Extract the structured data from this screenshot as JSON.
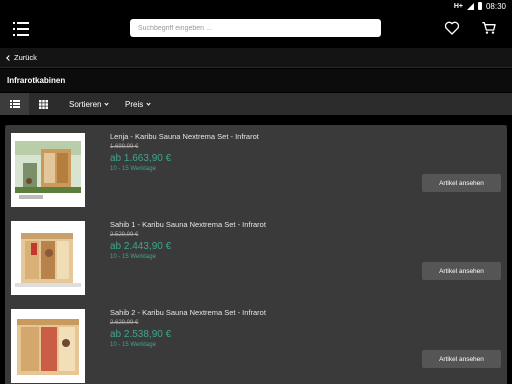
{
  "status_bar": {
    "network": "H+",
    "time": "08:30"
  },
  "header": {
    "menu_icon": "menu-icon",
    "search_placeholder": "Suchbegriff eingeben ...",
    "wishlist_icon": "heart-icon",
    "cart_icon": "cart-icon"
  },
  "nav": {
    "back_label": "Zurück"
  },
  "category": {
    "title": "Infrarotkabinen"
  },
  "toolbar": {
    "list_view_icon": "list-view-icon",
    "grid_view_icon": "grid-view-icon",
    "sort_label": "Sortieren",
    "price_label": "Preis"
  },
  "products": [
    {
      "name": "Lenja - Karibu Sauna Nextrema Set - Infrarot",
      "old_price": "1.699,99 €",
      "price": "ab 1.663,90 €",
      "delivery": "10 - 15 Werktage",
      "button": "Artikel ansehen"
    },
    {
      "name": "Sahib 1 - Karibu Sauna Nextrema Set - Infrarot",
      "old_price": "2.529,99 €",
      "price": "ab 2.443,90 €",
      "delivery": "10 - 15 Werktage",
      "button": "Artikel ansehen"
    },
    {
      "name": "Sahib 2 - Karibu Sauna Nextrema Set - Infrarot",
      "old_price": "2.629,99 €",
      "price": "ab 2.538,90 €",
      "delivery": "10 - 15 Werktage",
      "button": "Artikel ansehen"
    }
  ],
  "colors": {
    "accent": "#3fa68e",
    "background": "#000000",
    "panel": "#3a3a3a",
    "button": "#555555"
  }
}
